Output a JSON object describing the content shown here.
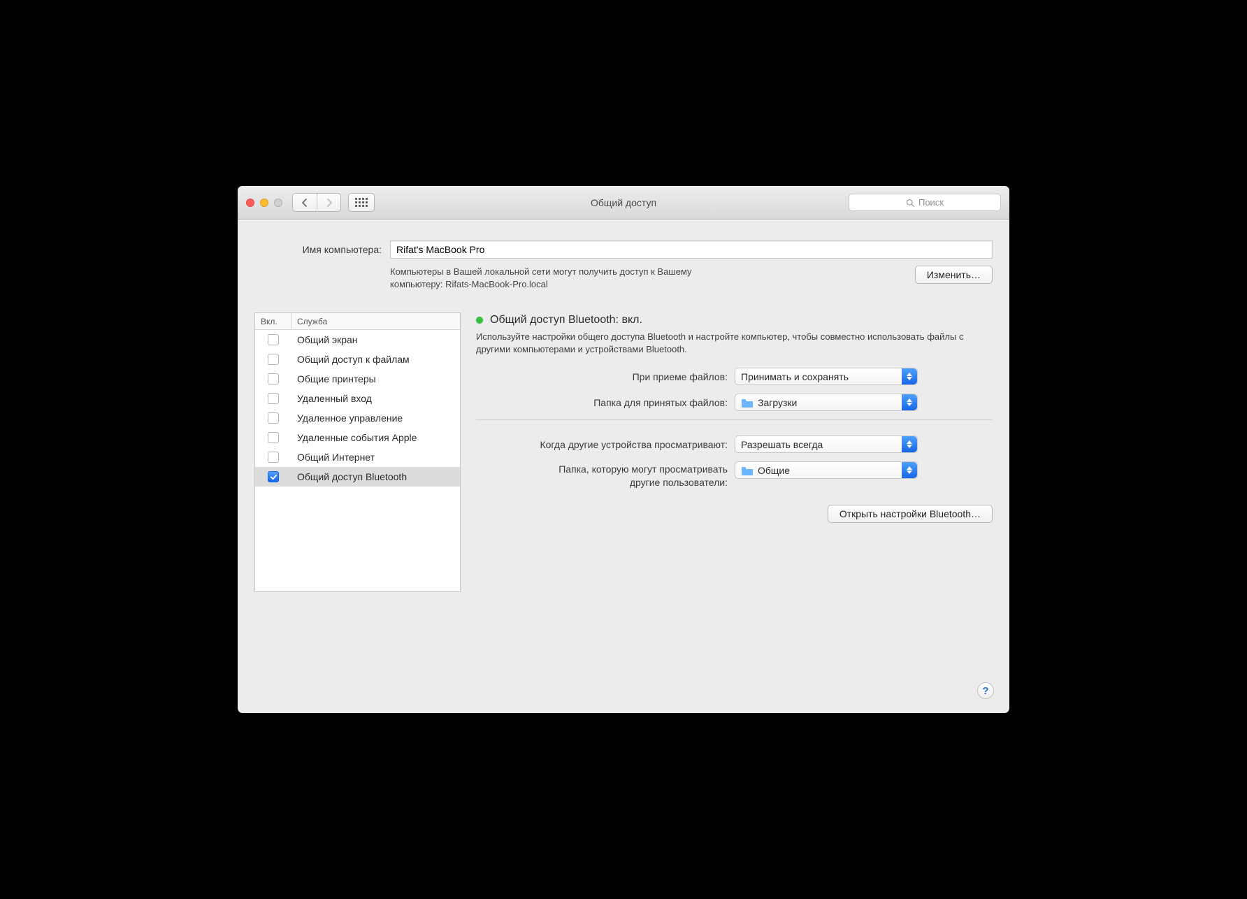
{
  "window": {
    "title": "Общий доступ"
  },
  "search": {
    "placeholder": "Поиск"
  },
  "computer_name": {
    "label": "Имя компьютера:",
    "value": "Rifat's MacBook Pro",
    "description_line1": "Компьютеры в Вашей локальной сети могут получить доступ к Вашему",
    "description_line2": "компьютеру: Rifats-MacBook-Pro.local",
    "edit_button": "Изменить…"
  },
  "services": {
    "col_on": "Вкл.",
    "col_service": "Служба",
    "items": [
      {
        "checked": false,
        "label": "Общий экран"
      },
      {
        "checked": false,
        "label": "Общий доступ к файлам"
      },
      {
        "checked": false,
        "label": "Общие принтеры"
      },
      {
        "checked": false,
        "label": "Удаленный вход"
      },
      {
        "checked": false,
        "label": "Удаленное управление"
      },
      {
        "checked": false,
        "label": "Удаленные события Apple"
      },
      {
        "checked": false,
        "label": "Общий Интернет"
      },
      {
        "checked": true,
        "label": "Общий доступ Bluetooth"
      }
    ],
    "selected_index": 7
  },
  "detail": {
    "status_title": "Общий доступ Bluetooth: вкл.",
    "status_color": "#32c13a",
    "description": "Используйте настройки общего доступа Bluetooth и настройте компьютер, чтобы совместно использовать файлы с другими компьютерами и устройствами Bluetooth.",
    "receive_label": "При приеме файлов:",
    "receive_value": "Принимать и сохранять",
    "receive_folder_label": "Папка для принятых файлов:",
    "receive_folder_value": "Загрузки",
    "browse_label": "Когда другие устройства просматривают:",
    "browse_value": "Разрешать всегда",
    "browse_folder_label_l1": "Папка, которую могут просматривать",
    "browse_folder_label_l2": "другие пользователи:",
    "browse_folder_value": "Общие",
    "open_bt_button": "Открыть настройки Bluetooth…"
  },
  "help_glyph": "?"
}
